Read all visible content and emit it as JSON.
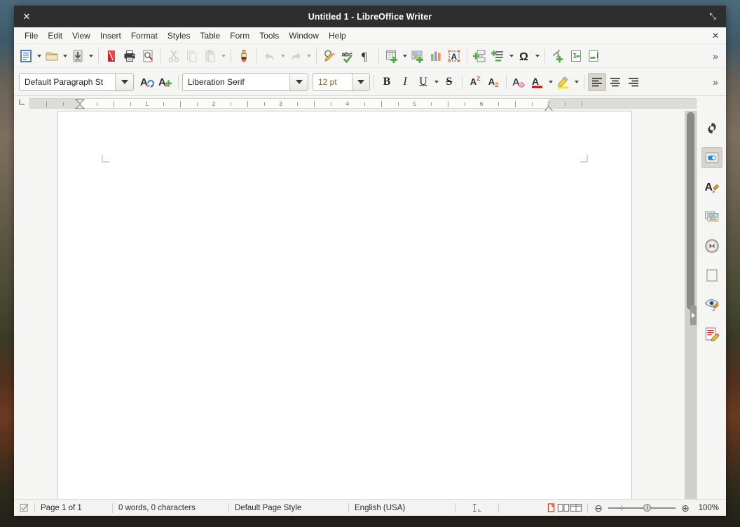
{
  "window": {
    "title": "Untitled 1 - LibreOffice Writer",
    "close_glyph": "✕",
    "maximize_glyph": "⤡",
    "doc_close_glyph": "✕"
  },
  "menubar": {
    "items": [
      {
        "label": "File",
        "name": "menu-file"
      },
      {
        "label": "Edit",
        "name": "menu-edit"
      },
      {
        "label": "View",
        "name": "menu-view"
      },
      {
        "label": "Insert",
        "name": "menu-insert"
      },
      {
        "label": "Format",
        "name": "menu-format"
      },
      {
        "label": "Styles",
        "name": "menu-styles"
      },
      {
        "label": "Table",
        "name": "menu-table"
      },
      {
        "label": "Form",
        "name": "menu-form"
      },
      {
        "label": "Tools",
        "name": "menu-tools"
      },
      {
        "label": "Window",
        "name": "menu-window"
      },
      {
        "label": "Help",
        "name": "menu-help"
      }
    ]
  },
  "toolbar_standard": {
    "overflow_glyph": "»",
    "tools": [
      "new-document-icon",
      "open-file-icon",
      "save-icon",
      "export-pdf-icon",
      "print-icon",
      "print-preview-icon",
      "cut-icon",
      "copy-icon",
      "paste-icon",
      "clone-formatting-icon",
      "undo-icon",
      "redo-icon",
      "find-replace-icon",
      "spelling-icon",
      "formatting-marks-icon",
      "insert-table-icon",
      "insert-image-icon",
      "insert-chart-icon",
      "insert-text-box-icon",
      "insert-page-break-icon",
      "insert-field-icon",
      "special-character-icon",
      "hyperlink-icon",
      "footnote-icon",
      "endnote-icon"
    ]
  },
  "toolbar_formatting": {
    "paragraph_style": "Default Paragraph St",
    "font_name": "Liberation Serif",
    "font_size": "12 pt",
    "bold_label": "B",
    "italic_label": "I",
    "underline_label": "U",
    "strikethrough_label": "S",
    "superscript_label": "A",
    "superscript_sup": "2",
    "subscript_label": "A",
    "subscript_sub": "2",
    "overflow_glyph": "»",
    "active_alignment": "left"
  },
  "ruler": {
    "unit": "inch",
    "numbers": [
      "1",
      "2",
      "3",
      "4",
      "5",
      "6",
      "7"
    ],
    "left_indent_position": "1",
    "right_indent_position": "7"
  },
  "statusbar": {
    "save_state_icon": "document-saved-icon",
    "page_info": "Page 1 of 1",
    "word_count": "0 words, 0 characters",
    "page_style": "Default Page Style",
    "language": "English (USA)",
    "selection_mode_icon": "text-selection-mode-icon",
    "view_layouts": [
      {
        "name": "single-page-view-icon",
        "active": true
      },
      {
        "name": "multi-page-view-icon",
        "active": false
      },
      {
        "name": "book-view-icon",
        "active": false
      }
    ],
    "zoom_out_glyph": "⊖",
    "zoom_in_glyph": "⊕",
    "zoom_level": "100%"
  },
  "sidebar": {
    "items": [
      {
        "name": "sidebar-settings-icon",
        "label": "Sidebar Settings",
        "active": false
      },
      {
        "name": "sidebar-properties-icon",
        "label": "Properties",
        "active": true
      },
      {
        "name": "sidebar-styles-icon",
        "label": "Styles",
        "active": false
      },
      {
        "name": "sidebar-gallery-icon",
        "label": "Gallery",
        "active": false
      },
      {
        "name": "sidebar-navigator-icon",
        "label": "Navigator",
        "active": false
      },
      {
        "name": "sidebar-page-icon",
        "label": "Page",
        "active": false
      },
      {
        "name": "sidebar-style-inspector-icon",
        "label": "Style Inspector",
        "active": false
      },
      {
        "name": "sidebar-manage-changes-icon",
        "label": "Manage Changes",
        "active": false
      }
    ]
  },
  "document": {
    "content": ""
  }
}
